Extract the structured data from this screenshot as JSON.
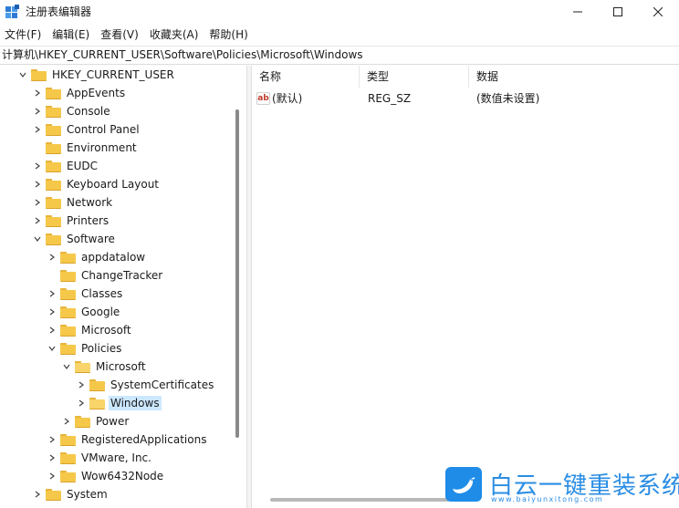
{
  "window": {
    "title": "注册表编辑器",
    "minimize_label": "—",
    "maximize_label": "☐",
    "close_label": "✕"
  },
  "menu": [
    "文件(F)",
    "编辑(E)",
    "查看(V)",
    "收藏夹(A)",
    "帮助(H)"
  ],
  "address": "计算机\\HKEY_CURRENT_USER\\Software\\Policies\\Microsoft\\Windows",
  "tree": [
    {
      "label": "HKEY_CURRENT_USER",
      "expanded": true,
      "selected": false
    },
    {
      "label": "AppEvents",
      "expanded": false,
      "selected": false
    },
    {
      "label": "Console",
      "expanded": false,
      "selected": false
    },
    {
      "label": "Control Panel",
      "expanded": false,
      "selected": false
    },
    {
      "label": "Environment",
      "expanded": false,
      "selected": false
    },
    {
      "label": "EUDC",
      "expanded": false,
      "selected": false
    },
    {
      "label": "Keyboard Layout",
      "expanded": false,
      "selected": false
    },
    {
      "label": "Network",
      "expanded": false,
      "selected": false
    },
    {
      "label": "Printers",
      "expanded": false,
      "selected": false
    },
    {
      "label": "Software",
      "expanded": true,
      "selected": false
    },
    {
      "label": "appdatalow",
      "expanded": false,
      "selected": false
    },
    {
      "label": "ChangeTracker",
      "expanded": false,
      "selected": false
    },
    {
      "label": "Classes",
      "expanded": false,
      "selected": false
    },
    {
      "label": "Google",
      "expanded": false,
      "selected": false
    },
    {
      "label": "Microsoft",
      "expanded": false,
      "selected": false
    },
    {
      "label": "Policies",
      "expanded": true,
      "selected": false
    },
    {
      "label": "Microsoft",
      "expanded": true,
      "selected": false
    },
    {
      "label": "SystemCertificates",
      "expanded": false,
      "selected": false
    },
    {
      "label": "Windows",
      "expanded": false,
      "selected": true
    },
    {
      "label": "Power",
      "expanded": false,
      "selected": false
    },
    {
      "label": "RegisteredApplications",
      "expanded": false,
      "selected": false
    },
    {
      "label": "VMware, Inc.",
      "expanded": false,
      "selected": false
    },
    {
      "label": "Wow6432Node",
      "expanded": false,
      "selected": false
    },
    {
      "label": "System",
      "expanded": false,
      "selected": false
    }
  ],
  "values_pane": {
    "headers": {
      "name": "名称",
      "type": "类型",
      "data": "数据"
    },
    "rows": [
      {
        "icon": "string-value-icon",
        "icon_text": "ab",
        "name": "(默认)",
        "type": "REG_SZ",
        "data": "(数值未设置)"
      }
    ]
  },
  "watermark": {
    "text": "白云一键重装系统",
    "url": "www.baiyunxitong.com"
  },
  "colors": {
    "selection": "#cce8ff",
    "folder": "#f6c84a",
    "watermark": "#2a8de4"
  }
}
